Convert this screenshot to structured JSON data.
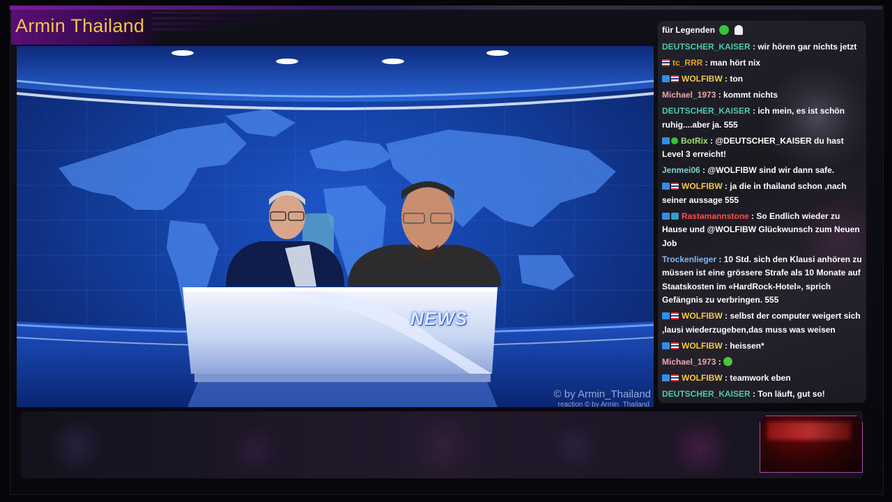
{
  "channel": {
    "title": "Armin Thailand"
  },
  "video": {
    "desk_label": "NEWS",
    "watermark": "© by Armin_Thailand",
    "watermark_small": "reaction  © by Armin_Thailand"
  },
  "chat": {
    "header": "für Legenden",
    "header_icons": [
      "green-emote-icon",
      "white-emote-icon"
    ],
    "messages": [
      {
        "user": "DEUTSCHER_KAISER",
        "color": "#4ec9b0",
        "badges": [],
        "text": " : wir hören gar nichts jetzt"
      },
      {
        "user": "tc_RRR",
        "color": "#e6a02a",
        "badges": [
          "flag"
        ],
        "text": " : man hört nix"
      },
      {
        "user": "WOLFIBW",
        "color": "#f2c94c",
        "badges": [
          "prime",
          "flag"
        ],
        "text": " : ton"
      },
      {
        "user": "Michael_1973",
        "color": "#e8a7a7",
        "badges": [],
        "text": " : kommt nichts"
      },
      {
        "user": "DEUTSCHER_KAISER",
        "color": "#4ec9b0",
        "badges": [],
        "text": " : ich mein, es ist schön ruhig....aber ja. 555"
      },
      {
        "user": "BotRix",
        "color": "#9be36b",
        "badges": [
          "prime",
          "check"
        ],
        "text": " : @DEUTSCHER_KAISER du hast Level 3 erreicht!"
      },
      {
        "user": "Jenmei06",
        "color": "#7fd3d3",
        "badges": [],
        "text": " : @WOLFIBW sind wir dann safe."
      },
      {
        "user": "WOLFIBW",
        "color": "#f2c94c",
        "badges": [
          "prime",
          "flag"
        ],
        "text": " : ja die in thailand schon ,nach seiner aussage 555"
      },
      {
        "user": "Rastamannstone",
        "color": "#ff4d4d",
        "badges": [
          "prime",
          "game"
        ],
        "text": " : So Endlich wieder zu Hause und @WOLFIBW Glückwunsch zum Neuen Job"
      },
      {
        "user": "Trockenlieger",
        "color": "#7fb7ff",
        "badges": [],
        "text": " : 10 Std. sich den Klausi anhören zu müssen ist eine grössere Strafe als 10 Monate auf Staatskosten im «HardRock-Hotel», sprich Gefängnis zu verbringen. 555"
      },
      {
        "user": "WOLFIBW",
        "color": "#f2c94c",
        "badges": [
          "prime",
          "flag"
        ],
        "text": " : selbst der computer weigert sich ,lausi wiederzugeben,das muss was weisen"
      },
      {
        "user": "WOLFIBW",
        "color": "#f2c94c",
        "badges": [
          "prime",
          "flag"
        ],
        "text": " : heissen*"
      },
      {
        "user": "Michael_1973",
        "color": "#e8a7a7",
        "badges": [],
        "text": " : ",
        "emote": true
      },
      {
        "user": "WOLFIBW",
        "color": "#f2c94c",
        "badges": [
          "prime",
          "flag"
        ],
        "text": " : teamwork eben"
      },
      {
        "user": "DEUTSCHER_KAISER",
        "color": "#4ec9b0",
        "badges": [],
        "text": " : Ton läuft, gut so!"
      }
    ]
  }
}
